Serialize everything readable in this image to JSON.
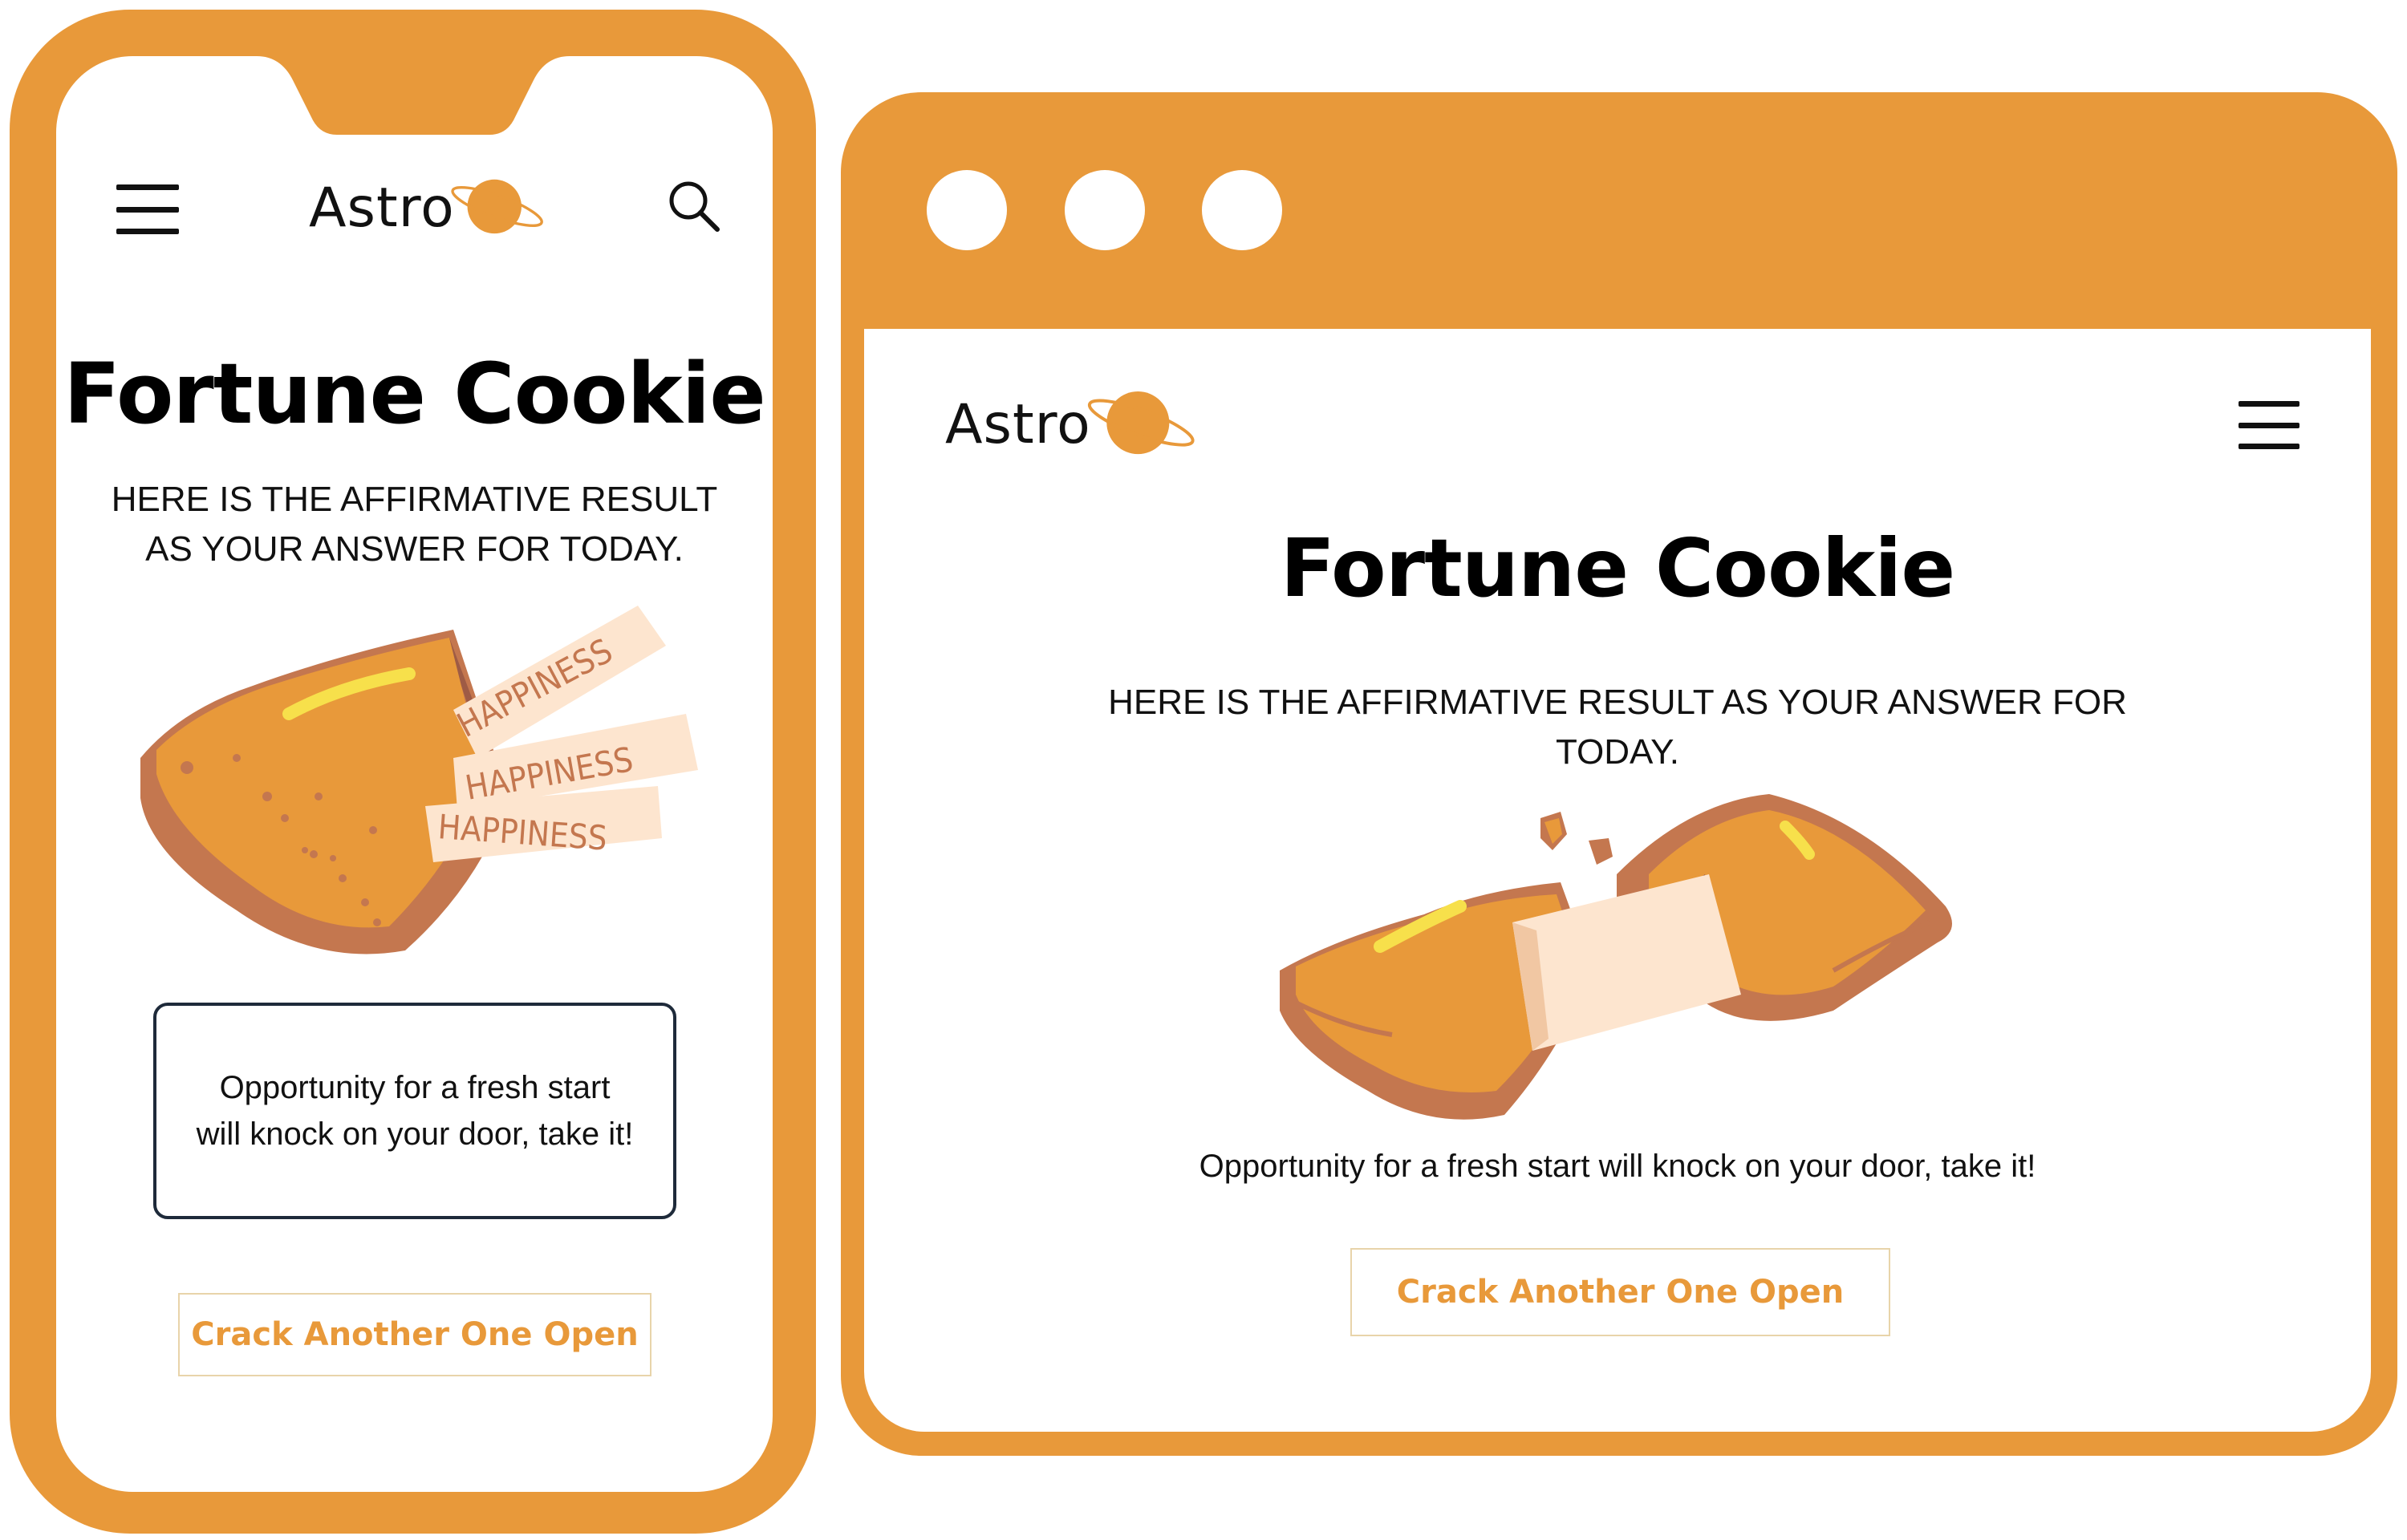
{
  "colors": {
    "accent": "#e8993a",
    "cookie_light": "#e8993a",
    "cookie_dark": "#c4774f",
    "paper": "#fde5cf",
    "highlight": "#f7e04b",
    "button_border": "#e8d4aa",
    "box_border": "#1e2a3a"
  },
  "mobile": {
    "menu_icon": "hamburger-icon",
    "search_icon": "search-icon",
    "logo_text": "Astro",
    "title": "Fortune Cookie",
    "subtitle_line1": "HERE IS THE AFFIRMATIVE RESULT",
    "subtitle_line2": "AS YOUR ANSWER FOR TODAY.",
    "paper_word": "HAPPINESS",
    "fortune_line1": "Opportunity for a fresh start",
    "fortune_line2": "will knock on your door, take it!",
    "button_label": "Crack Another One Open"
  },
  "desktop": {
    "logo_text": "Astro",
    "menu_icon": "hamburger-icon",
    "title": "Fortune Cookie",
    "subtitle_line1": "HERE IS THE AFFIRMATIVE RESULT AS YOUR ANSWER FOR",
    "subtitle_line2": "TODAY.",
    "fortune": "Opportunity for a fresh start will knock on your door, take it!",
    "button_label": "Crack Another One Open"
  }
}
